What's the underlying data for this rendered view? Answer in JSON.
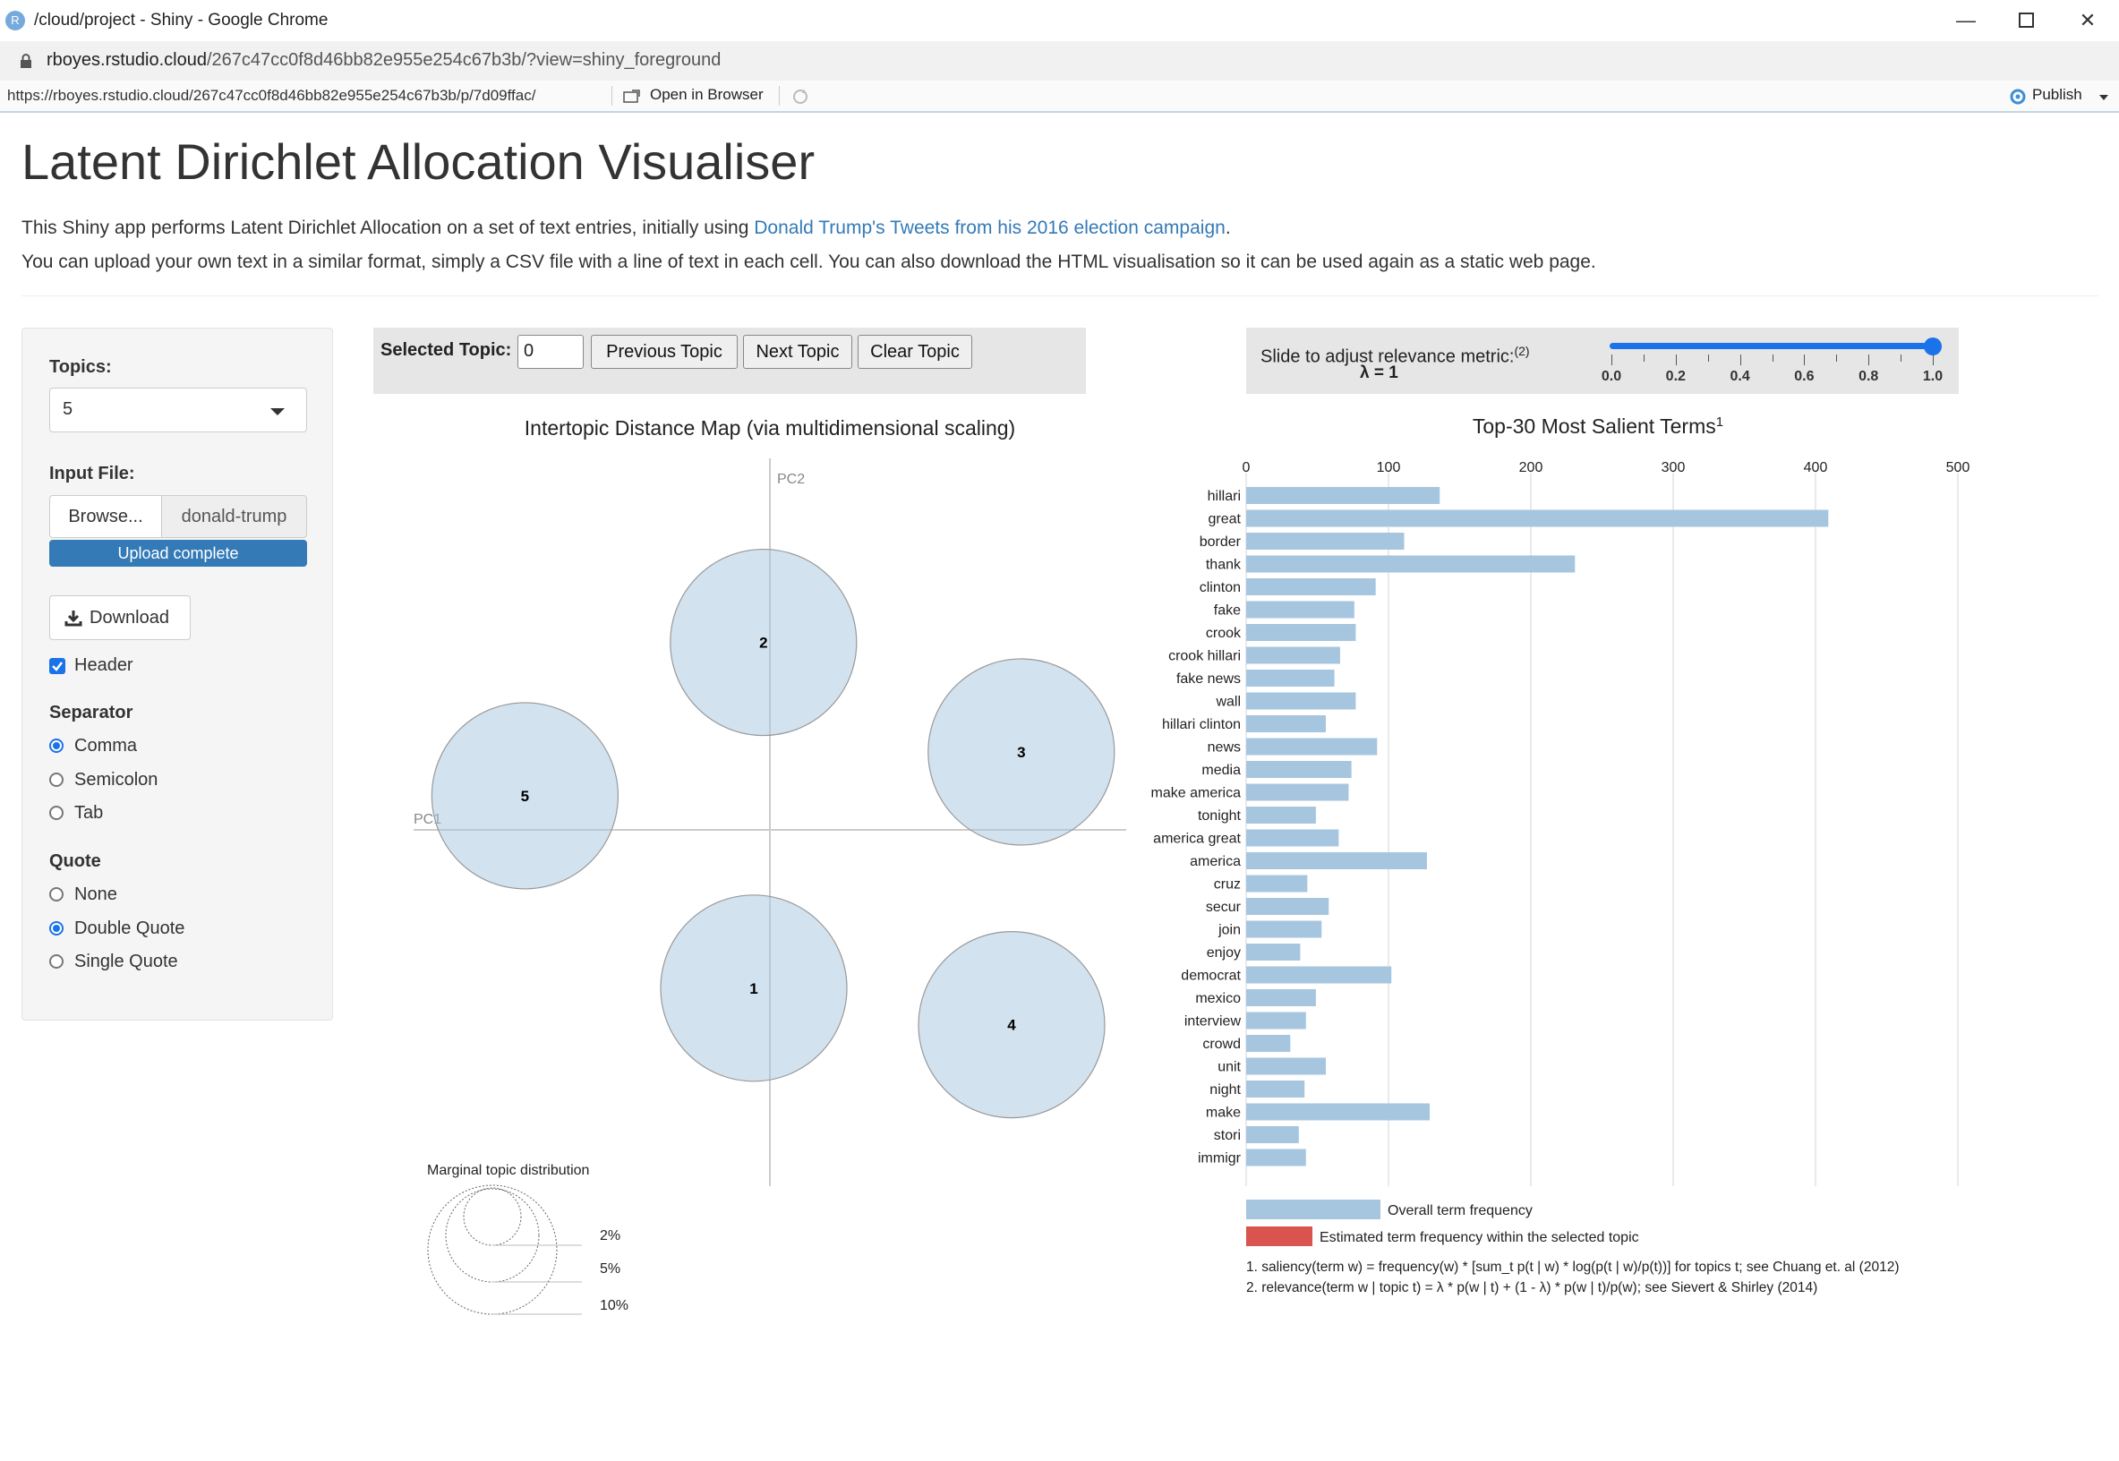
{
  "window": {
    "title": "/cloud/project - Shiny - Google Chrome",
    "favicon_letter": "R",
    "url_host": "rboyes.rstudio.cloud",
    "url_path": "/267c47cc0f8d46bb82e955e254c67b3b/?view=shiny_foreground"
  },
  "rstudio_bar": {
    "app_url": "https://rboyes.rstudio.cloud/267c47cc0f8d46bb82e955e254c67b3b/p/7d09ffac/",
    "open_in_browser": "Open in Browser",
    "publish": "Publish"
  },
  "page": {
    "title": "Latent Dirichlet Allocation Visualiser",
    "desc1_prefix": "This Shiny app performs Latent Dirichlet Allocation on a set of text entries, initially using ",
    "desc1_link": "Donald Trump's Tweets from his 2016 election campaign",
    "desc1_suffix": ".",
    "desc2": "You can upload your own text in a similar format, simply a CSV file with a line of text in each cell. You can also download the HTML visualisation so it can be used again as a static web page."
  },
  "sidebar": {
    "topics_label": "Topics:",
    "topics_value": "5",
    "input_file_label": "Input File:",
    "browse_label": "Browse...",
    "file_name": "donald-trump",
    "upload_status": "Upload complete",
    "download_label": "Download",
    "header_label": "Header",
    "header_checked": true,
    "separator_label": "Separator",
    "separator_options": [
      "Comma",
      "Semicolon",
      "Tab"
    ],
    "separator_selected": "Comma",
    "quote_label": "Quote",
    "quote_options": [
      "None",
      "Double Quote",
      "Single Quote"
    ],
    "quote_selected": "Double Quote"
  },
  "topic_controls": {
    "selected_label": "Selected Topic:",
    "selected_value": "0",
    "previous": "Previous Topic",
    "next": "Next Topic",
    "clear": "Clear Topic"
  },
  "relevance": {
    "label": "Slide to adjust relevance metric:",
    "footnote": "(2)",
    "lambda_text": "λ = 1",
    "lambda": 1.0,
    "ticks": [
      "0.0",
      "0.2",
      "0.4",
      "0.6",
      "0.8",
      "1.0"
    ]
  },
  "intertopic": {
    "title": "Intertopic Distance Map (via multidimensional scaling)",
    "pc1": "PC1",
    "pc2": "PC2",
    "topics": [
      {
        "id": "1",
        "pc1": -0.05,
        "pc2": -0.65,
        "size": 1
      },
      {
        "id": "2",
        "pc1": -0.02,
        "pc2": 0.77,
        "size": 1
      },
      {
        "id": "3",
        "pc1": 0.78,
        "pc2": 0.32,
        "size": 1
      },
      {
        "id": "4",
        "pc1": 0.75,
        "pc2": -0.8,
        "size": 1
      },
      {
        "id": "5",
        "pc1": -0.76,
        "pc2": 0.14,
        "size": 1
      }
    ],
    "marginal_title": "Marginal topic distribution",
    "marginal_labels": [
      "2%",
      "5%",
      "10%"
    ]
  },
  "chart_data": {
    "type": "bar",
    "title": "Top-30 Most Salient Terms",
    "title_footnote": "1",
    "categories": [
      "hillari",
      "great",
      "border",
      "thank",
      "clinton",
      "fake",
      "crook",
      "crook hillari",
      "fake news",
      "wall",
      "hillari clinton",
      "news",
      "media",
      "make america",
      "tonight",
      "america great",
      "america",
      "cruz",
      "secur",
      "join",
      "enjoy",
      "democrat",
      "mexico",
      "interview",
      "crowd",
      "unit",
      "night",
      "make",
      "stori",
      "immigr"
    ],
    "values": [
      136,
      409,
      111,
      231,
      91,
      76,
      77,
      66,
      62,
      77,
      56,
      92,
      74,
      72,
      49,
      65,
      127,
      43,
      58,
      53,
      38,
      102,
      49,
      42,
      31,
      56,
      41,
      129,
      37,
      42
    ],
    "xlim": [
      0,
      500
    ],
    "xticks": [
      "0",
      "100",
      "200",
      "300",
      "400",
      "500"
    ],
    "bar_color": "#a6c6e0",
    "legend": [
      "Overall term frequency",
      "Estimated term frequency within the selected topic"
    ],
    "legend_colors": [
      "#a6c6e0",
      "#d9534f"
    ],
    "notes": [
      "1. saliency(term w) = frequency(w) * [sum_t p(t | w) * log(p(t | w)/p(t))] for topics t; see Chuang et. al (2012)",
      "2. relevance(term w | topic t) = λ * p(w | t) + (1 - λ) * p(w | t)/p(w); see Sievert & Shirley (2014)"
    ]
  }
}
